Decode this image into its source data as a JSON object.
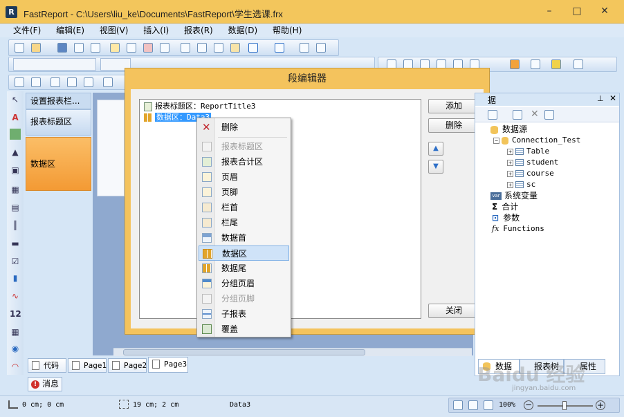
{
  "window": {
    "title": "FastReport - C:\\Users\\liu_ke\\Documents\\FastReport\\学生选课.frx",
    "minimize": "–",
    "maximize": "□",
    "close": "✕"
  },
  "menu": [
    "文件(F)",
    "编辑(E)",
    "视图(V)",
    "插入(I)",
    "报表(R)",
    "数据(D)",
    "帮助(H)"
  ],
  "band_panel": {
    "header": "设置报表栏...",
    "items": [
      "报表标题区",
      "数据区"
    ],
    "colors": {
      "data_band": "#f9a642",
      "title_band": "#c9dcf1"
    }
  },
  "dialog": {
    "title": "段编辑器",
    "bands": [
      {
        "label": "报表标题区：ReportTitle3",
        "selected": false
      },
      {
        "label": "数据区：Data3",
        "selected": true
      }
    ],
    "buttons": {
      "add": "添加",
      "delete": "删除",
      "close": "关闭"
    }
  },
  "context_menu": {
    "items": [
      {
        "label": "删除",
        "icon": "delete-x-icon",
        "disabled": false
      },
      {
        "label": "报表标题区",
        "icon": "report-title-icon",
        "disabled": true
      },
      {
        "label": "报表合计区",
        "icon": "report-summary-icon",
        "disabled": false
      },
      {
        "label": "页眉",
        "icon": "page-header-icon",
        "disabled": false
      },
      {
        "label": "页脚",
        "icon": "page-footer-icon",
        "disabled": false
      },
      {
        "label": "栏首",
        "icon": "column-header-icon",
        "disabled": false
      },
      {
        "label": "栏尾",
        "icon": "column-footer-icon",
        "disabled": false
      },
      {
        "label": "数据首",
        "icon": "data-header-icon",
        "disabled": false
      },
      {
        "label": "数据区",
        "icon": "data-band-icon",
        "disabled": false,
        "selected": true
      },
      {
        "label": "数据尾",
        "icon": "data-footer-icon",
        "disabled": false
      },
      {
        "label": "分组页眉",
        "icon": "group-header-icon",
        "disabled": false
      },
      {
        "label": "分组页脚",
        "icon": "group-footer-icon",
        "disabled": true
      },
      {
        "label": "子报表",
        "icon": "child-band-icon",
        "disabled": false
      },
      {
        "label": "覆盖",
        "icon": "overlay-icon",
        "disabled": false
      }
    ]
  },
  "right_panel": {
    "tabs": [
      "数据",
      "报表树",
      "属性"
    ],
    "header_partial": "据",
    "tree": [
      {
        "label": "数据源",
        "level": 0,
        "icon": "database-icon"
      },
      {
        "label": "Connection_Test",
        "level": 1,
        "icon": "connection-icon"
      },
      {
        "label": "Table",
        "level": 2,
        "icon": "table-icon"
      },
      {
        "label": "student",
        "level": 2,
        "icon": "table-icon"
      },
      {
        "label": "course",
        "level": 2,
        "icon": "table-icon"
      },
      {
        "label": "sc",
        "level": 2,
        "icon": "table-icon"
      },
      {
        "label": "系统变量",
        "level": 0,
        "icon": "variable-icon"
      },
      {
        "label": "合计",
        "level": 0,
        "icon": "sigma-icon"
      },
      {
        "label": "参数",
        "level": 0,
        "icon": "parameter-icon"
      },
      {
        "label": "Functions",
        "level": 0,
        "icon": "function-icon"
      }
    ]
  },
  "bottom_tabs": [
    "代码",
    "Page1",
    "Page2",
    "Page3"
  ],
  "message_tab": "消息",
  "status": {
    "position": "0 cm; 0 cm",
    "size": "19 cm; 2 cm",
    "object": "Data3",
    "zoom": "100%"
  },
  "watermark": {
    "text": "Baidu 经验",
    "sub": "jingyan.baidu.com"
  }
}
